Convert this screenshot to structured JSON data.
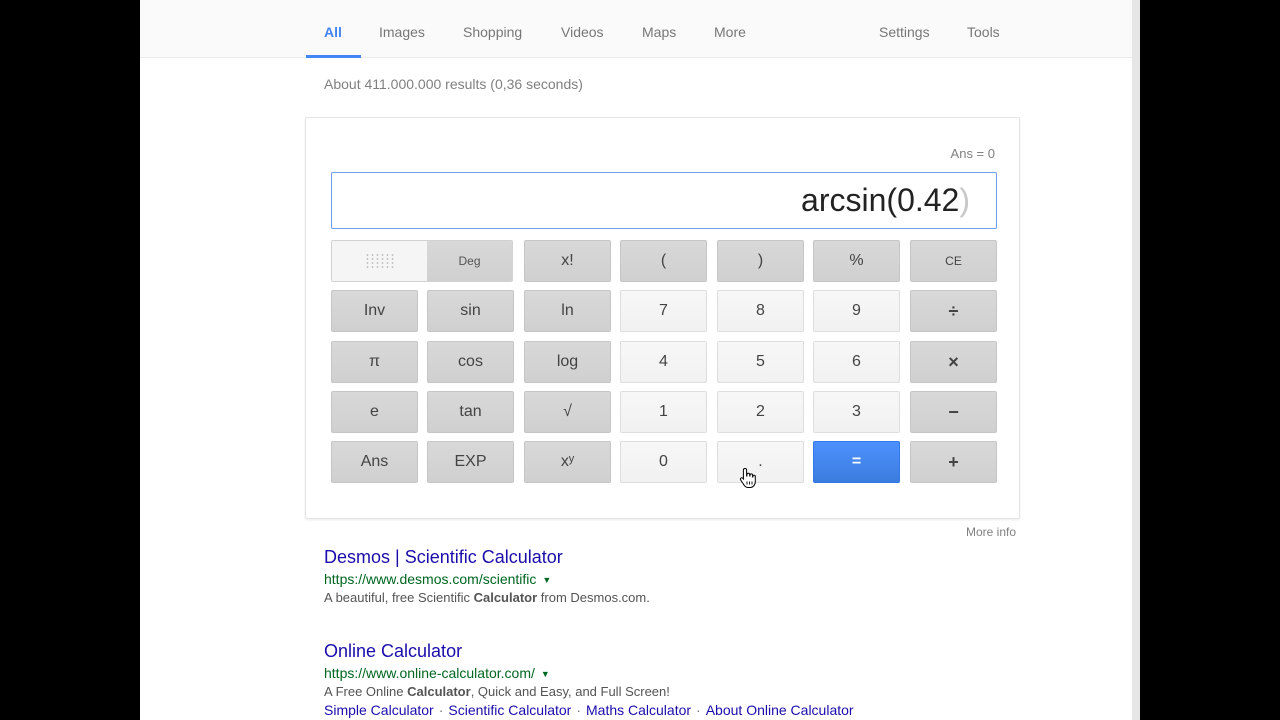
{
  "nav": {
    "tabs": [
      {
        "label": "All",
        "active": true
      },
      {
        "label": "Images"
      },
      {
        "label": "Shopping"
      },
      {
        "label": "Videos"
      },
      {
        "label": "Maps"
      },
      {
        "label": "More"
      }
    ],
    "settings": "Settings",
    "tools": "Tools"
  },
  "stats": "About 411.000.000 results (0,36 seconds)",
  "calculator": {
    "ans_label": "Ans = 0",
    "expression": "arcsin(0.42",
    "expression_ghost": ")",
    "mode_toggle": {
      "rad_label": "",
      "deg_label": "Deg",
      "selected": "Deg"
    },
    "buttons": {
      "fact": "x!",
      "lparen": "(",
      "rparen": ")",
      "percent": "%",
      "ce": "CE",
      "inv": "Inv",
      "sin": "sin",
      "ln": "ln",
      "seven": "7",
      "eight": "8",
      "nine": "9",
      "divide": "÷",
      "pi": "π",
      "cos": "cos",
      "log": "log",
      "four": "4",
      "five": "5",
      "six": "6",
      "multiply": "×",
      "e": "e",
      "tan": "tan",
      "sqrt": "√",
      "one": "1",
      "two": "2",
      "three": "3",
      "minus": "−",
      "ans": "Ans",
      "exp": "EXP",
      "pow": "xʸ",
      "zero": "0",
      "dot": ".",
      "equals": "=",
      "plus": "+"
    },
    "accent_color": "#4285f4",
    "more_info": "More info"
  },
  "results": [
    {
      "title": "Desmos | Scientific Calculator",
      "url": "https://www.desmos.com/scientific",
      "snippet_pre": "A beautiful, free Scientific ",
      "snippet_bold": "Calculator",
      "snippet_post": " from Desmos.com."
    },
    {
      "title": "Online Calculator",
      "url": "https://www.online-calculator.com/",
      "snippet_pre": "A Free Online ",
      "snippet_bold": "Calculator",
      "snippet_post": ", Quick and Easy, and Full Screen!",
      "sitelinks": [
        "Simple Calculator",
        "Scientific Calculator",
        "Maths Calculator",
        "About Online Calculator"
      ]
    }
  ]
}
